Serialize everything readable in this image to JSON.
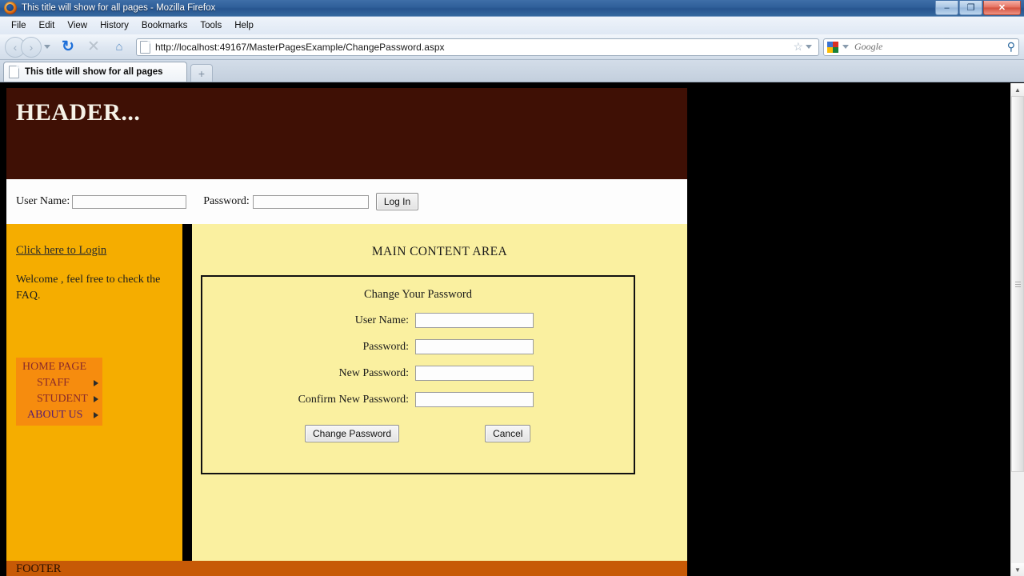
{
  "browser": {
    "window_title": "This title will show for all pages - Mozilla Firefox",
    "window_title_ghost": "",
    "icon": "firefox-icon",
    "window_controls": {
      "minimize": "–",
      "maximize": "❐",
      "close": "✕"
    },
    "menu": [
      "File",
      "Edit",
      "View",
      "History",
      "Bookmarks",
      "Tools",
      "Help"
    ],
    "toolbar": {
      "back_icon": "‹",
      "forward_icon": "›",
      "reload_icon": "↻",
      "stop_icon": "✕",
      "home_icon": "⌂",
      "star_icon": "☆",
      "magnifier_icon": "⚲"
    },
    "url": "http://localhost:49167/MasterPagesExample/ChangePassword.aspx",
    "search_placeholder": "Google",
    "tab": {
      "title": "This title will show for all pages",
      "new_tab_icon": "+"
    }
  },
  "site": {
    "header_title": "HEADER...",
    "login_bar": {
      "username_label": "User Name:",
      "username_value": "",
      "password_label": "Password:",
      "password_value": "",
      "login_button": "Log In"
    },
    "sidebar": {
      "login_link": "Click here to Login",
      "welcome_text": "Welcome , feel free to check the FAQ.",
      "menu": [
        {
          "label": "HOME PAGE",
          "has_arrow": false,
          "level": "root"
        },
        {
          "label": "STAFF",
          "has_arrow": true,
          "level": "child"
        },
        {
          "label": "STUDENT",
          "has_arrow": true,
          "level": "child"
        },
        {
          "label": "ABOUT US",
          "has_arrow": true,
          "level": "last"
        }
      ]
    },
    "main": {
      "area_title": "MAIN CONTENT AREA",
      "panel_title": "Change Your Password",
      "fields": [
        {
          "label": "User Name:",
          "value": ""
        },
        {
          "label": "Password:",
          "value": ""
        },
        {
          "label": "New Password:",
          "value": ""
        },
        {
          "label": "Confirm New Password:",
          "value": ""
        }
      ],
      "submit_button": "Change Password",
      "cancel_button": "Cancel"
    },
    "footer_text": "FOOTER"
  },
  "colors": {
    "header_bg": "#3f1005",
    "sidebar_bg": "#f5ad00",
    "menu_bg": "#f68c0e",
    "content_bg": "#faf0a0",
    "footer_bg": "#c75a06"
  }
}
